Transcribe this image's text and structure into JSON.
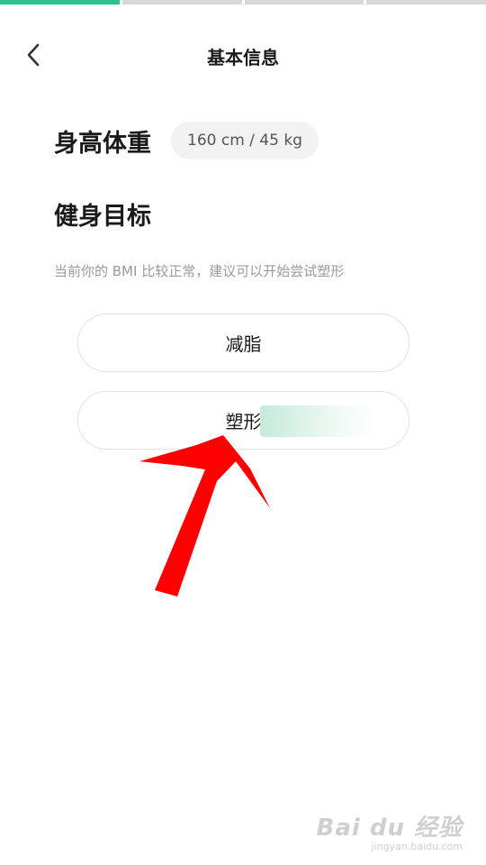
{
  "progress": {
    "total_steps": 4,
    "completed_steps": 1,
    "accent": "#29c48b"
  },
  "header": {
    "title": "基本信息",
    "back_icon": "chevron-left-icon"
  },
  "profile": {
    "label": "身高体重",
    "value": "160 cm / 45 kg"
  },
  "goal": {
    "title": "健身目标",
    "hint": "当前你的 BMI 比较正常，建议可以开始尝试塑形",
    "options": [
      {
        "label": "减脂"
      },
      {
        "label": "塑形"
      }
    ]
  },
  "annotation": {
    "color": "#ff0000"
  },
  "watermark": {
    "brand": "Bai du 经验",
    "url": "jingyan.baidu.com"
  }
}
